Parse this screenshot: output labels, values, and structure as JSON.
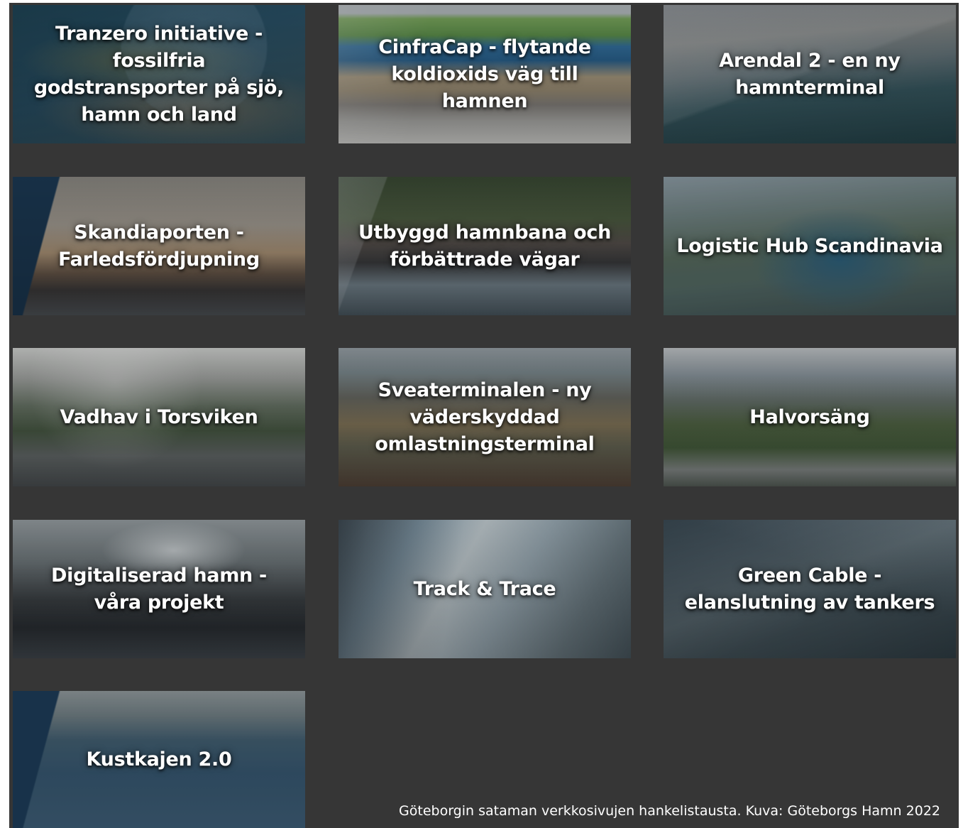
{
  "tiles": [
    {
      "label": "Tranzero initiative - fossilfria godstransporter på sjö, hamn och land",
      "icon": "aerial-island-image"
    },
    {
      "label": "CinfraCap - flytande koldioxids väg till hamnen",
      "icon": "geology-diagram-image"
    },
    {
      "label": "Arendal 2 - en ny hamnterminal",
      "icon": "port-aerial-image"
    },
    {
      "label": "Skandiaporten - Farledsfördjupning",
      "icon": "container-ship-image"
    },
    {
      "label": "Utbyggd hamnbana och förbättrade vägar",
      "icon": "train-bridge-image"
    },
    {
      "label": "Logistic Hub Scandinavia",
      "icon": "city-river-image"
    },
    {
      "label": "Vadhav i Torsviken",
      "icon": "bird-coast-image"
    },
    {
      "label": "Sveaterminalen - ny väderskyddad omlastningsterminal",
      "icon": "rail-terminal-image"
    },
    {
      "label": "Halvorsäng",
      "icon": "warehouse-aerial-image"
    },
    {
      "label": "Digitaliserad hamn - våra projekt",
      "icon": "cranes-tablet-image"
    },
    {
      "label": "Track & Trace",
      "icon": "tablet-railway-image"
    },
    {
      "label": "Green Cable - elanslutning av tankers",
      "icon": "tanker-quay-image"
    },
    {
      "label": "Kustkajen 2.0",
      "icon": "jetty-aerial-image"
    }
  ],
  "caption": "Göteborgin sataman verkkosivujen hankelistausta. Kuva: Göteborgs Hamn 2022"
}
